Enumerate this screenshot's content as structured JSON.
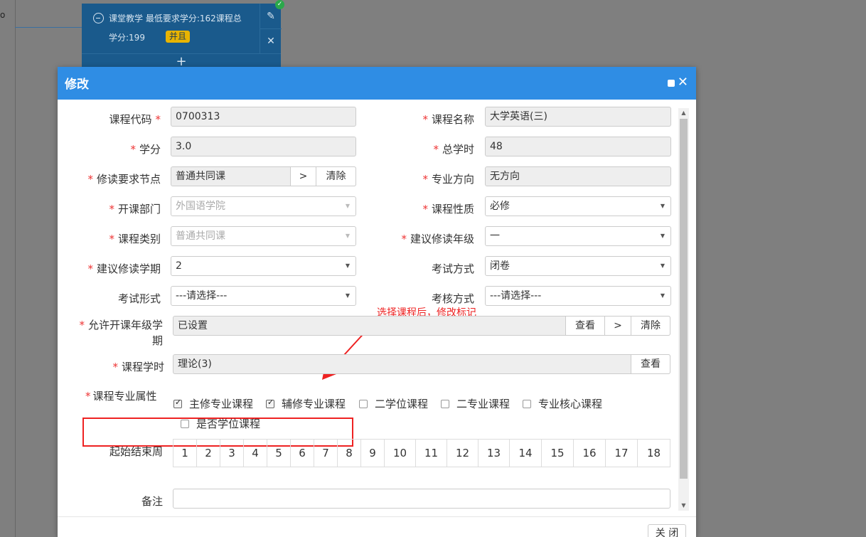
{
  "background": {
    "card_line1": "课堂教学   最低要求学分:162课程总",
    "card_line2": "学分:199",
    "card_badge": "并且",
    "card_plus": "+",
    "dot": "o"
  },
  "modal": {
    "title": "修改",
    "close_label": "关 闭",
    "fields": {
      "course_code": {
        "label": "课程代码",
        "value": "0700313"
      },
      "course_name": {
        "label": "课程名称",
        "value": "大学英语(三)"
      },
      "credit": {
        "label": "学分",
        "value": "3.0"
      },
      "total_hours": {
        "label": "总学时",
        "value": "48"
      },
      "node": {
        "label": "修读要求节点",
        "value": "普通共同课",
        "btn_select": ">",
        "btn_clear": "清除"
      },
      "direction": {
        "label": "专业方向",
        "value": "无方向"
      },
      "department": {
        "label": "开课部门",
        "value": "外国语学院"
      },
      "nature": {
        "label": "课程性质",
        "value": "必修"
      },
      "category": {
        "label": "课程类别",
        "value": "普通共同课"
      },
      "grade": {
        "label": "建议修读年级",
        "value": "一"
      },
      "term": {
        "label": "建议修读学期",
        "value": "2"
      },
      "exam_mode": {
        "label": "考试方式",
        "value": "闭卷"
      },
      "exam_form": {
        "label": "考试形式",
        "value": "---请选择---"
      },
      "assess_mode": {
        "label": "考核方式",
        "value": "---请选择---"
      },
      "allowed_terms": {
        "label": "允许开课年级学期",
        "value": "已设置",
        "btn_view": "查看",
        "btn_select": ">",
        "btn_clear": "清除"
      },
      "course_hours": {
        "label": "课程学时",
        "value": "理论(3)",
        "btn_view": "查看"
      },
      "attributes": {
        "label": "课程专业属性",
        "options": [
          {
            "label": "主修专业课程",
            "checked": true
          },
          {
            "label": "辅修专业课程",
            "checked": true
          },
          {
            "label": "二学位课程",
            "checked": false
          },
          {
            "label": "二专业课程",
            "checked": false
          },
          {
            "label": "专业核心课程",
            "checked": false
          },
          {
            "label": "是否学位课程",
            "checked": false
          }
        ]
      },
      "weeks": {
        "label": "起始结束周",
        "items": [
          "1",
          "2",
          "3",
          "4",
          "5",
          "6",
          "7",
          "8",
          "9",
          "10",
          "11",
          "12",
          "13",
          "14",
          "15",
          "16",
          "17",
          "18"
        ]
      },
      "remark": {
        "label": "备注",
        "value": ""
      }
    },
    "annotation": "选择课程后，修改标记"
  },
  "colors": {
    "header": "#2f8de4",
    "required": "#ee3333",
    "annotation": "#ee2222",
    "card": "#1a5a8c",
    "badge": "#e8b400"
  }
}
